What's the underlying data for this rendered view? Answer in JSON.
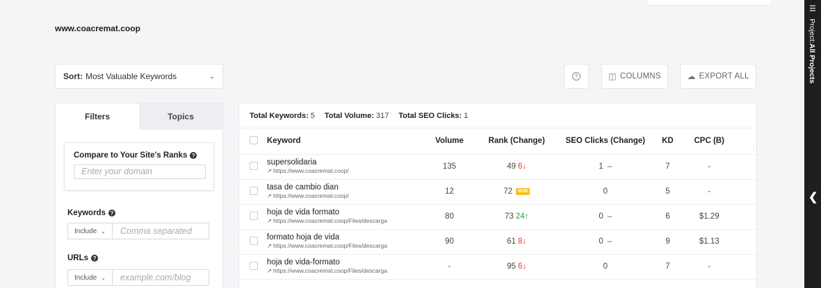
{
  "site": {
    "title": "www.coacremat.coop"
  },
  "sort": {
    "label": "Sort:",
    "value": "Most Valuable Keywords"
  },
  "toolbar": {
    "help": "?",
    "columns": "COLUMNS",
    "export": "EXPORT ALL"
  },
  "filters": {
    "tabs": [
      {
        "label": "Filters"
      },
      {
        "label": "Topics"
      }
    ],
    "compare_label": "Compare to Your Site's Ranks",
    "domain_placeholder": "Enter your domain",
    "keywords_label": "Keywords",
    "keywords_include": "Include",
    "keywords_placeholder": "Comma separated",
    "urls_label": "URLs",
    "urls_include": "Include",
    "urls_placeholder": "example.com/blog"
  },
  "totals": {
    "keywords_label": "Total Keywords:",
    "keywords_value": "5",
    "volume_label": "Total Volume:",
    "volume_value": "317",
    "clicks_label": "Total SEO Clicks:",
    "clicks_value": "1"
  },
  "table": {
    "headers": {
      "keyword": "Keyword",
      "volume": "Volume",
      "rank": "Rank (Change)",
      "seo": "SEO Clicks (Change)",
      "kd": "KD",
      "cpc": "CPC (B)"
    },
    "rows": [
      {
        "keyword": "supersolidaria",
        "url": "https://www.coacremat.coop/",
        "volume": "135",
        "rank": "49",
        "change": "6",
        "change_dir": "down",
        "seo": "1",
        "seo_change": "–",
        "kd": "7",
        "cpc": "-"
      },
      {
        "keyword": "tasa de cambio dian",
        "url": "https://www.coacremat.coop/",
        "volume": "12",
        "rank": "72",
        "change": "NEW",
        "change_dir": "new",
        "seo": "0",
        "seo_change": "",
        "kd": "5",
        "cpc": "-"
      },
      {
        "keyword": "hoja de vida formato",
        "url": "https://www.coacremat.coop/Files/descarga",
        "volume": "80",
        "rank": "73",
        "change": "24",
        "change_dir": "up",
        "seo": "0",
        "seo_change": "–",
        "kd": "6",
        "cpc": "$1.29"
      },
      {
        "keyword": "formato hoja de vida",
        "url": "https://www.coacremat.coop/Files/descarga",
        "volume": "90",
        "rank": "61",
        "change": "8",
        "change_dir": "down",
        "seo": "0",
        "seo_change": "–",
        "kd": "9",
        "cpc": "$1.13"
      },
      {
        "keyword": "hoja de vida-formato",
        "url": "https://www.coacremat.coop/Files/descarga",
        "volume": "-",
        "rank": "95",
        "change": "6",
        "change_dir": "down",
        "seo": "0",
        "seo_change": "",
        "kd": "7",
        "cpc": "-"
      }
    ]
  },
  "sidebar": {
    "project_label": "Project:",
    "project_value": "All Projects"
  },
  "icons": {
    "help": "help-circle-icon",
    "columns": "columns-icon",
    "export": "cloud-download-icon",
    "menu": "menu-icon",
    "collapse": "chevron-left-icon",
    "external": "external-link-icon"
  },
  "colors": {
    "down": "#e53935",
    "up": "#2e9e4a",
    "new_badge": "#f7c21c",
    "sidebar": "#1e1e1e"
  }
}
